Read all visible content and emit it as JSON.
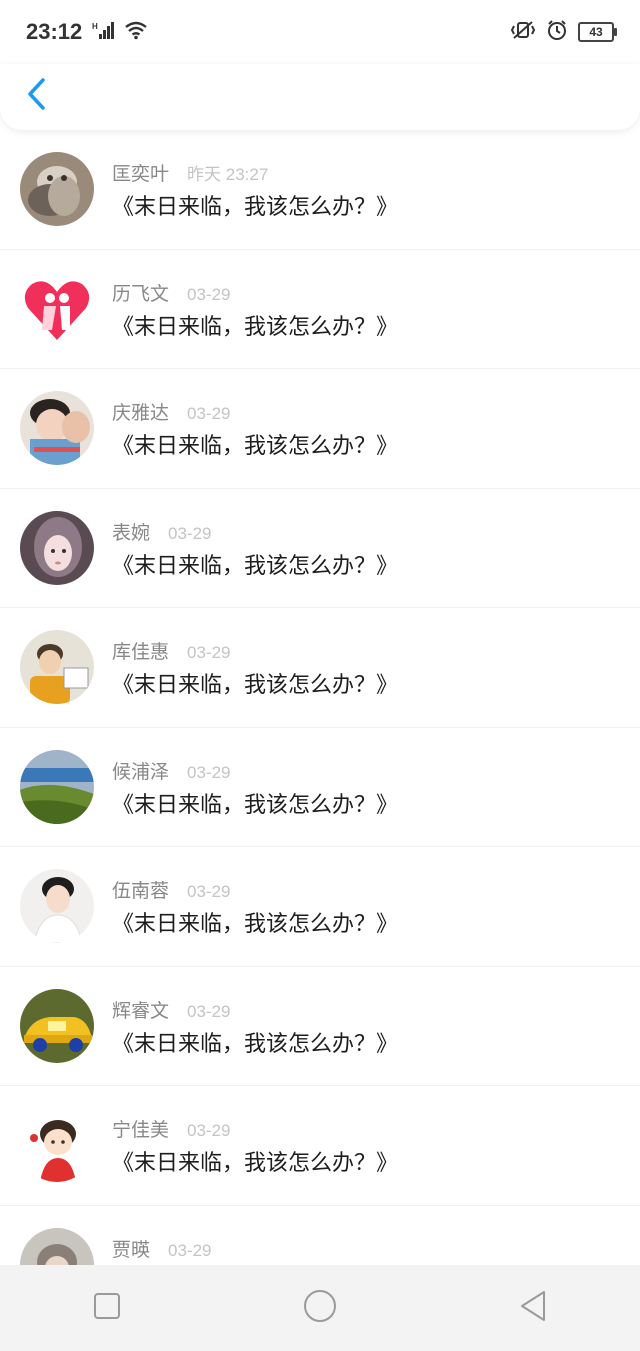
{
  "status_bar": {
    "time": "23:12",
    "network_label": "H",
    "battery_level": "43"
  },
  "header": {
    "back_icon": "chevron-left-icon",
    "accent_color": "#1a9bf0"
  },
  "messages": [
    {
      "name": "匡奕叶",
      "date": "昨天 23:27",
      "text": "《末日来临，我该怎么办？》",
      "avatar": "cat-photo"
    },
    {
      "name": "历飞文",
      "date": "03-29",
      "text": "《末日来临，我该怎么办？》",
      "avatar": "heart-couple"
    },
    {
      "name": "庆雅达",
      "date": "03-29",
      "text": "《末日来临，我该怎么办？》",
      "avatar": "boy-photo"
    },
    {
      "name": "表婉",
      "date": "03-29",
      "text": "《末日来临，我该怎么办？》",
      "avatar": "girl-photo"
    },
    {
      "name": "库佳惠",
      "date": "03-29",
      "text": "《末日来临，我该怎么办？》",
      "avatar": "man-sign-photo"
    },
    {
      "name": "候浦泽",
      "date": "03-29",
      "text": "《末日来临，我该怎么办？》",
      "avatar": "landscape-photo"
    },
    {
      "name": "伍南蓉",
      "date": "03-29",
      "text": "《末日来临，我该怎么办？》",
      "avatar": "young-man-photo"
    },
    {
      "name": "辉睿文",
      "date": "03-29",
      "text": "《末日来临，我该怎么办？》",
      "avatar": "toy-car-photo"
    },
    {
      "name": "宁佳美",
      "date": "03-29",
      "text": "《末日来临，我该怎么办？》",
      "avatar": "cartoon-boy"
    },
    {
      "name": "贾暎",
      "date": "03-29",
      "text": "",
      "avatar": "partial-photo"
    }
  ],
  "nav_bar": {
    "items": [
      "recent-apps-icon",
      "home-icon",
      "back-triangle-icon"
    ]
  }
}
